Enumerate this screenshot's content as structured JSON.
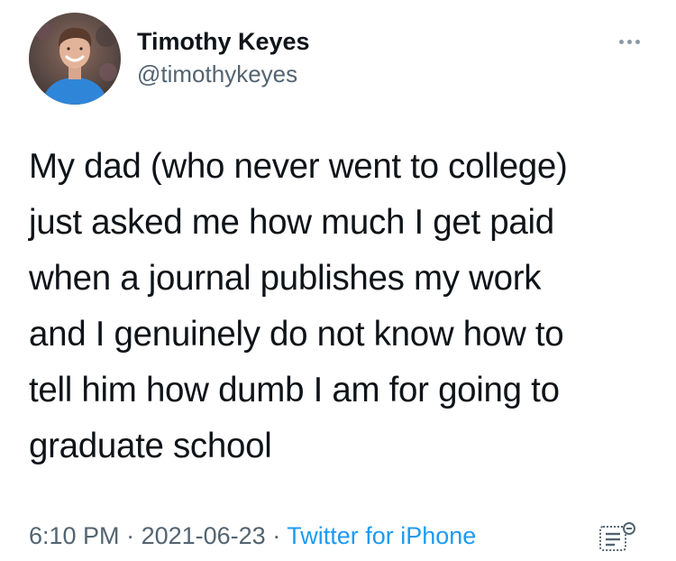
{
  "author": {
    "name": "Timothy Keyes",
    "handle": "@timothykeyes",
    "avatar_icon": "profile-photo"
  },
  "more_icon": "ellipsis-icon",
  "tweet": {
    "lines": [
      "My dad (who never went to college)",
      "just asked me how much I get paid",
      "when a journal publishes my work",
      "and I genuinely do not know how to",
      "tell him how dumb I am for going to",
      "graduate school"
    ]
  },
  "meta": {
    "time": "6:10 PM",
    "separator": " · ",
    "date": "2021-06-23",
    "source": "Twitter for iPhone"
  },
  "analytics_icon": "tweet-analytics-icon",
  "colors": {
    "text": "#0f1419",
    "muted": "#536471",
    "link": "#1d9bf0"
  }
}
